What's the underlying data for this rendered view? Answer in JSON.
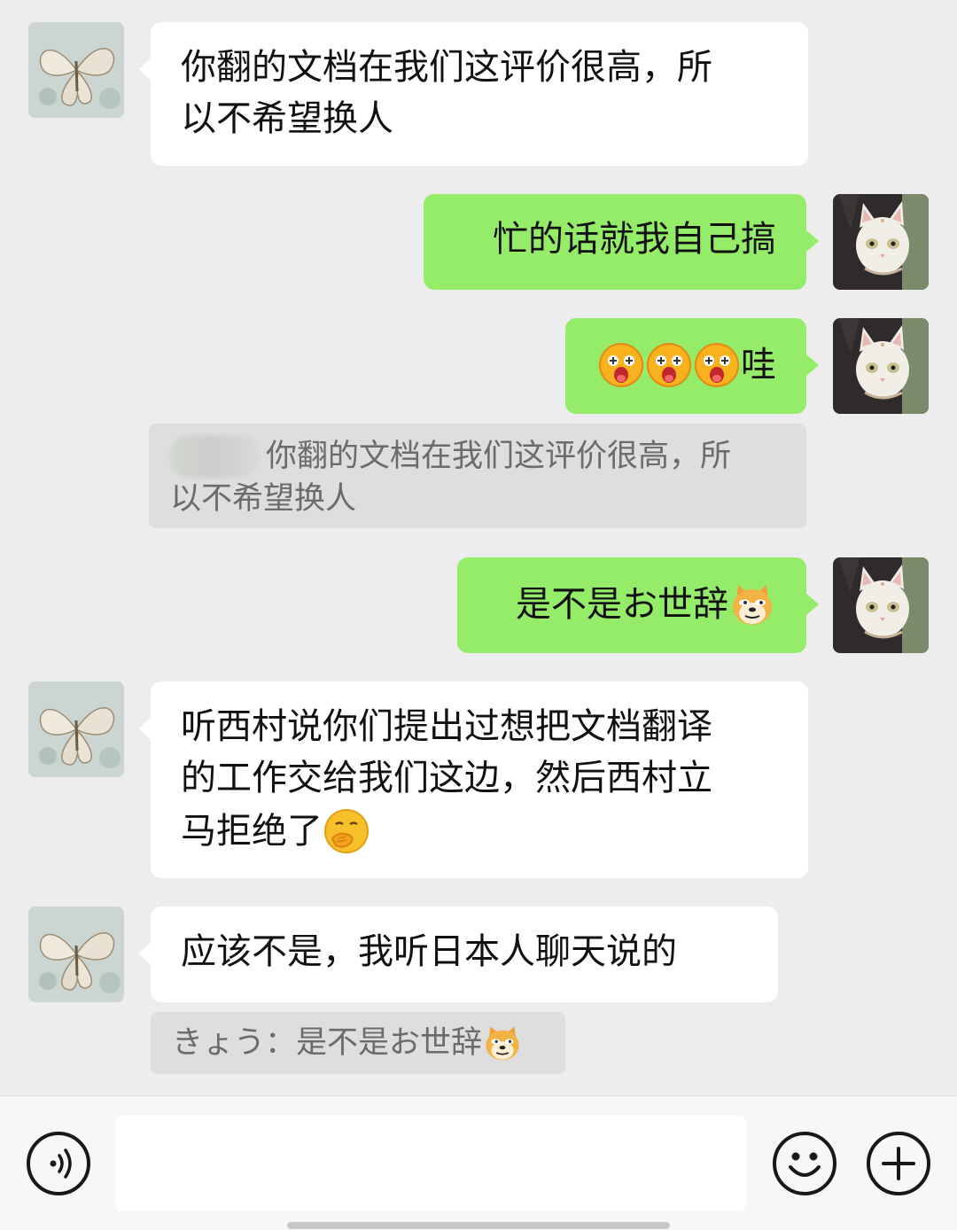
{
  "messages": [
    {
      "id": "m1",
      "side": "incoming",
      "lines": [
        "你翻的文档在我们这评价很高，所",
        "以不希望换人"
      ]
    },
    {
      "id": "m2",
      "side": "outgoing",
      "text": "忙的话就我自己搞"
    },
    {
      "id": "m3",
      "side": "outgoing",
      "text": "哇",
      "emoji": [
        "shocked-face-emoji",
        "shocked-face-emoji",
        "shocked-face-emoji"
      ]
    },
    {
      "id": "q1",
      "type": "quote",
      "lines": [
        "你翻的文档在我们这评价很高，所",
        "以不希望换人"
      ]
    },
    {
      "id": "m4",
      "side": "outgoing",
      "text": "是不是お世辞",
      "emoji": [
        "doge-emoji"
      ]
    },
    {
      "id": "m5",
      "side": "incoming",
      "lines": [
        "听西村说你们提出过想把文档翻译",
        "的工作交给我们这边，然后西村立",
        "马拒绝了"
      ],
      "emoji": [
        "facepalm-emoji"
      ]
    },
    {
      "id": "m6",
      "side": "incoming",
      "text": "应该不是，我听日本人聊天说的"
    },
    {
      "id": "q2",
      "type": "quote",
      "text": "きょう：是不是お世辞",
      "emoji": [
        "doge-emoji"
      ]
    }
  ],
  "input_bar": {
    "voice_icon": "voice-icon",
    "text_value": "",
    "emoji_icon": "smiley-icon",
    "plus_icon": "plus-icon"
  },
  "colors": {
    "background": "#ededed",
    "incoming_bubble": "#ffffff",
    "outgoing_bubble": "#95ec69",
    "quote": "#dedede"
  }
}
